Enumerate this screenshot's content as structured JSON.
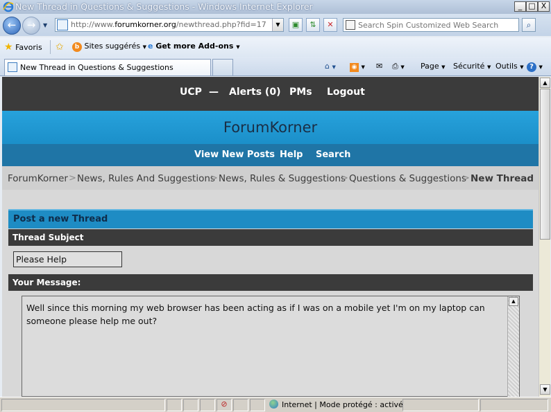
{
  "window": {
    "title": "New Thread in Questions & Suggestions - Windows Internet Explorer",
    "minimize": "_",
    "maximize": "□",
    "close": "X"
  },
  "address_bar": {
    "url_prefix": "http://www.",
    "url_domain": "forumkorner.org",
    "url_path": "/newthread.php?fid=17"
  },
  "search_bar": {
    "placeholder": "Search Spin Customized Web Search"
  },
  "favorites_bar": {
    "favorites": "Favoris",
    "suggested_sites": "Sites suggérés",
    "more_addons": "Get more Add-ons"
  },
  "tabs": [
    {
      "label": "New Thread in Questions & Suggestions"
    }
  ],
  "toolbar": {
    "page": "Page",
    "security": "Sécurité",
    "tools": "Outils"
  },
  "site": {
    "top_nav": {
      "ucp": "UCP",
      "dash": "—",
      "alerts": "Alerts (0)",
      "pms": "PMs",
      "logout": "Logout"
    },
    "title": "ForumKorner",
    "sub_nav": {
      "view_new_posts": "View New Posts",
      "help": "Help",
      "search": "Search"
    },
    "breadcrumb": {
      "items": [
        "ForumKorner",
        "News, Rules And Suggestions",
        "News, Rules & Suggestions",
        "Questions & Suggestions"
      ],
      "current": "New Thread",
      "separator": ">"
    },
    "form": {
      "heading": "Post a new Thread",
      "subject_label": "Thread Subject",
      "subject_value": "Please Help",
      "message_label": "Your Message:",
      "message_text": "Well since this morning my web browser has been acting as if I was on a mobile yet I'm on my laptop can someone please help me out?"
    }
  },
  "status_bar": {
    "zone": "Internet | Mode protégé : activé"
  },
  "colors": {
    "topbar": "#3b3b3b",
    "banner": "#27a2dc",
    "subnav": "#1f75a6",
    "panel_head": "#1e8cc4"
  }
}
